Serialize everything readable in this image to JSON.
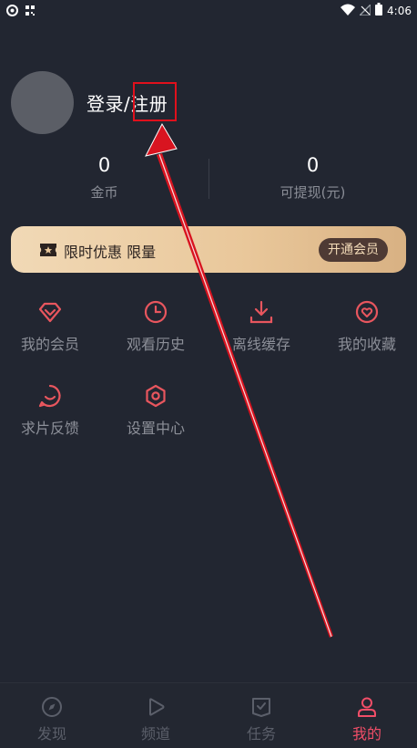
{
  "status_bar": {
    "time": "4:06"
  },
  "profile": {
    "login_label": "登录/注册"
  },
  "stats": [
    {
      "value": "0",
      "label": "金币"
    },
    {
      "value": "0",
      "label": "可提现(元)"
    }
  ],
  "vip_banner": {
    "title": "限时优惠 限量",
    "button": "开通会员"
  },
  "grid": [
    {
      "label": "我的会员",
      "icon": "diamond-icon"
    },
    {
      "label": "观看历史",
      "icon": "clock-icon"
    },
    {
      "label": "离线缓存",
      "icon": "download-icon"
    },
    {
      "label": "我的收藏",
      "icon": "heart-icon"
    },
    {
      "label": "求片反馈",
      "icon": "chat-smile-icon"
    },
    {
      "label": "设置中心",
      "icon": "settings-icon"
    }
  ],
  "tabs": [
    {
      "label": "发现",
      "icon": "compass-icon",
      "active": false
    },
    {
      "label": "频道",
      "icon": "play-icon",
      "active": false
    },
    {
      "label": "任务",
      "icon": "task-icon",
      "active": false
    },
    {
      "label": "我的",
      "icon": "user-icon",
      "active": true
    }
  ],
  "colors": {
    "background": "#222631",
    "accent": "#f24e68",
    "icon_accent": "#e8565e",
    "highlight_box": "#e0101c",
    "vip_gold": "#e9c79a"
  }
}
